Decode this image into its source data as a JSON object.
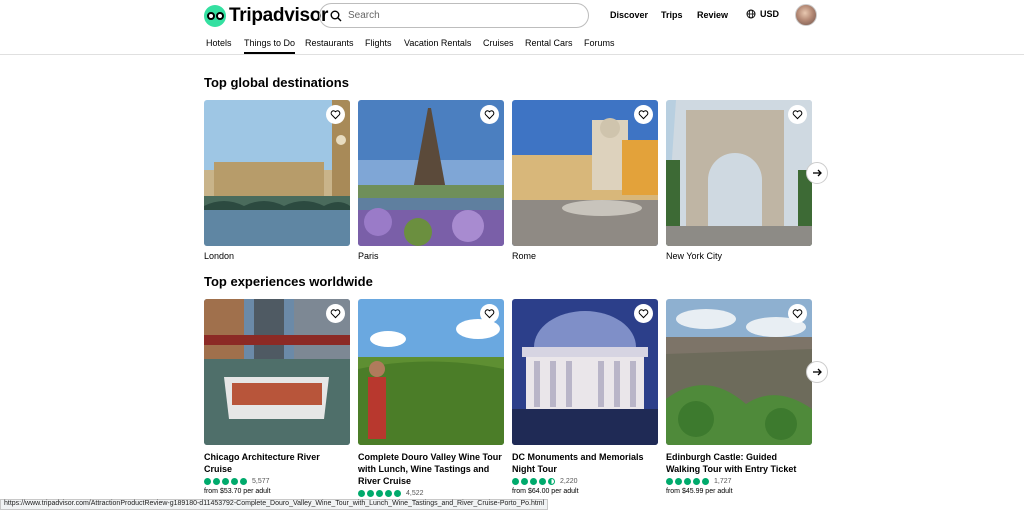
{
  "header": {
    "logo_text": "Tripadvisor",
    "search_placeholder": "Search",
    "nav": [
      "Discover",
      "Trips",
      "Review"
    ],
    "currency": "USD"
  },
  "categories": [
    "Hotels",
    "Things to Do",
    "Restaurants",
    "Flights",
    "Vacation Rentals",
    "Cruises",
    "Rental Cars",
    "Forums"
  ],
  "active_category": "Things to Do",
  "destinations": {
    "title": "Top global destinations",
    "items": [
      {
        "name": "London"
      },
      {
        "name": "Paris"
      },
      {
        "name": "Rome"
      },
      {
        "name": "New York City"
      }
    ]
  },
  "experiences": {
    "title": "Top experiences worldwide",
    "items": [
      {
        "name": "Chicago Architecture River Cruise",
        "rating": 5,
        "reviews": "5,577",
        "price": "from $53.70 per adult"
      },
      {
        "name": "Complete Douro Valley Wine Tour with Lunch, Wine Tastings and River Cruise",
        "rating": 5,
        "reviews": "4,522",
        "price": ""
      },
      {
        "name": "DC Monuments and Memorials Night Tour",
        "rating": 4.5,
        "reviews": "2,220",
        "price": "from $64.00 per adult"
      },
      {
        "name": "Edinburgh Castle: Guided Walking Tour with Entry Ticket",
        "rating": 5,
        "reviews": "1,727",
        "price": "from $45.99 per adult"
      }
    ]
  },
  "status_url": "https://www.tripadvisor.com/AttractionProductReview-g189180-d11453792-Complete_Douro_Valley_Wine_Tour_with_Lunch_Wine_Tastings_and_River_Cruise-Porto_Po.html",
  "colors": {
    "brand": "#34e0a1",
    "rating": "#00aa6c"
  }
}
